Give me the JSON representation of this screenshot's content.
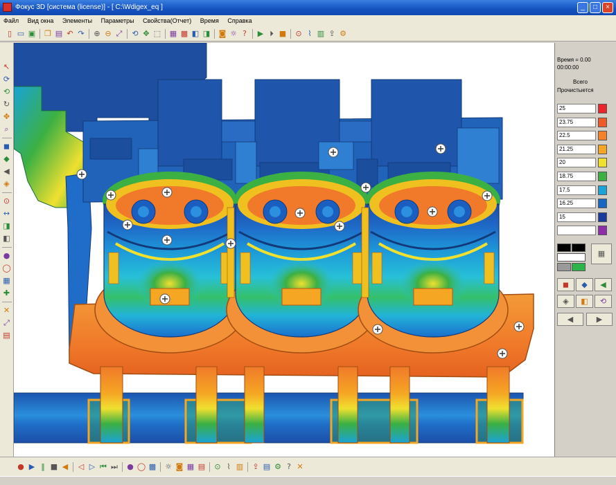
{
  "window": {
    "title": "Фокус 3D [система (license)] - [ C:\\Wdigex_eq ]",
    "minimize_glyph": "_",
    "maximize_glyph": "□",
    "close_glyph": "×"
  },
  "menu": [
    "Файл",
    "Вид окна",
    "Элементы",
    "Параметры",
    "Свойства(Отчет)",
    "Время",
    "Справка"
  ],
  "toolbar_icons": [
    "new-file-icon",
    "open-file-icon",
    "save-icon",
    "separator",
    "copy-icon",
    "paste-icon",
    "undo-icon",
    "redo-icon",
    "separator",
    "zoom-in-icon",
    "zoom-out-icon",
    "fit-view-icon",
    "separator",
    "rotate-icon",
    "pan-icon",
    "select-icon",
    "separator",
    "color-map-icon",
    "mesh-icon",
    "section-icon",
    "cut-plane-icon",
    "separator",
    "camera-icon",
    "light-icon",
    "help-icon",
    "separator",
    "play-icon",
    "step-icon",
    "stop-icon",
    "separator",
    "probe-icon",
    "graph-icon",
    "table-icon",
    "export-icon",
    "settings-icon"
  ],
  "left_toolbar_icons": [
    "pointer-icon",
    "rotate-x-icon",
    "rotate-y-icon",
    "rotate-z-icon",
    "pan-icon",
    "zoom-icon",
    "separator",
    "front-view-icon",
    "top-view-icon",
    "side-view-icon",
    "iso-view-icon",
    "separator",
    "probe-icon",
    "measure-icon",
    "cut-plane-icon",
    "section-icon",
    "separator",
    "shading-icon",
    "wireframe-icon",
    "grid-icon",
    "axes-icon",
    "separator",
    "close-icon",
    "fit-view-icon",
    "print-icon"
  ],
  "bottom_toolbar_icons": [
    "record-icon",
    "play-icon",
    "pause-icon",
    "stop-icon",
    "rewind-icon",
    "separator",
    "frame-back-icon",
    "frame-forward-icon",
    "first-frame-icon",
    "last-frame-icon",
    "separator",
    "shading-icon",
    "wireframe-icon",
    "mesh-icon",
    "separator",
    "light-icon",
    "camera-icon",
    "color-map-icon",
    "legend-icon",
    "separator",
    "probe-icon",
    "graph-icon",
    "table-icon",
    "separator",
    "export-icon",
    "print-icon",
    "settings-icon",
    "help-icon",
    "close-icon"
  ],
  "panel": {
    "time_label": "Время = 0.00",
    "time_value": "00:00:00",
    "mode_label": "Всего",
    "field_label": "Прочистыется",
    "legend": [
      {
        "value": "25",
        "color": "#e8262c"
      },
      {
        "value": "23.75",
        "color": "#ef5a28"
      },
      {
        "value": "22.5",
        "color": "#f4822a"
      },
      {
        "value": "21.25",
        "color": "#f5a623"
      },
      {
        "value": "20",
        "color": "#f0e030"
      },
      {
        "value": "18.75",
        "color": "#3cb043"
      },
      {
        "value": "17.5",
        "color": "#1aa3d6"
      },
      {
        "value": "16.25",
        "color": "#1866c4"
      },
      {
        "value": "15",
        "color": "#1a3b9c"
      },
      {
        "value": "",
        "color": "#8e2da8"
      }
    ],
    "palette": {
      "primary": "#000000",
      "secondary": "#000000",
      "background": "#ffffff",
      "mesh": "#9a9a9a",
      "accent": "#2cb34a"
    },
    "palette_button_icon": "palette-grid-icon",
    "view_buttons": [
      "front-view-icon",
      "top-view-icon",
      "side-view-icon",
      "iso-view-icon",
      "section-icon",
      "reset-view-icon"
    ],
    "step_buttons": [
      "previous-step-icon",
      "next-step-icon"
    ]
  }
}
